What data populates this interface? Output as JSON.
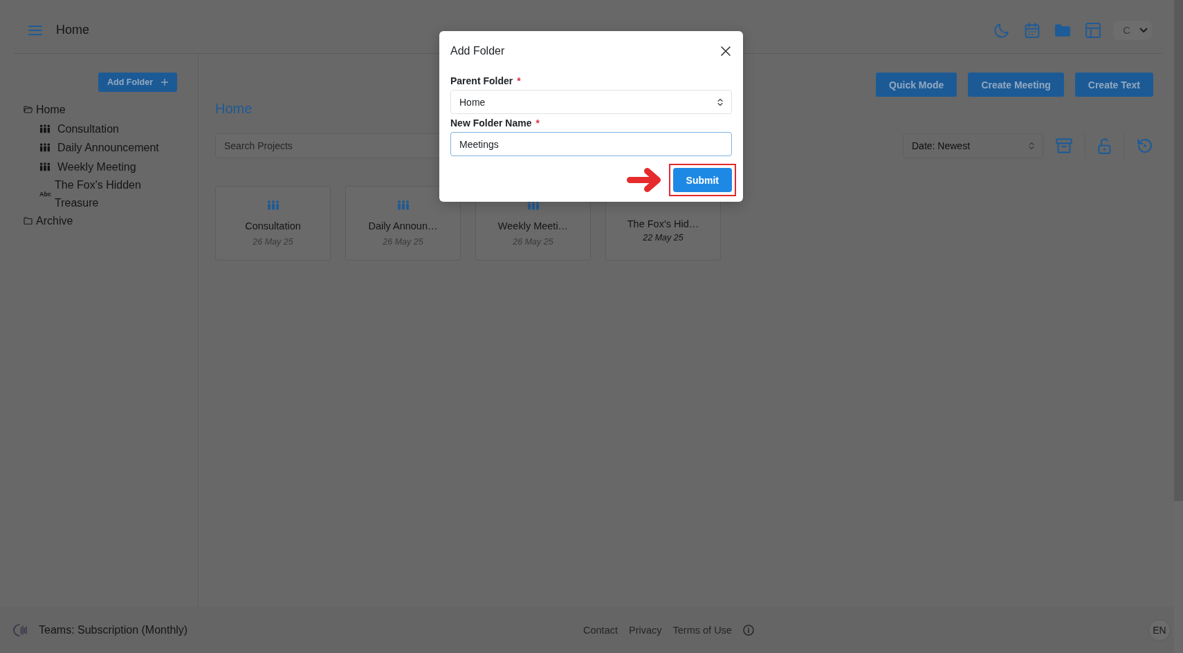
{
  "header": {
    "title": "Home",
    "user_initial": "C"
  },
  "sidebar": {
    "add_button": "Add Folder",
    "tree": [
      {
        "label": "Home",
        "kind": "folder",
        "expanded": true,
        "children": [
          {
            "label": "Consultation",
            "kind": "meeting"
          },
          {
            "label": "Daily Announcement",
            "kind": "meeting"
          },
          {
            "label": "Weekly Meeting",
            "kind": "meeting"
          },
          {
            "label": "The Fox's Hidden Treasure",
            "kind": "text",
            "icon_label": "Abc"
          }
        ]
      },
      {
        "label": "Archive",
        "kind": "folder",
        "expanded": false
      }
    ]
  },
  "main": {
    "actions": [
      "Quick Mode",
      "Create Meeting",
      "Create Text"
    ],
    "title": "Home",
    "search": {
      "placeholder": "Search Projects"
    },
    "sort": {
      "value": "Date: Newest"
    },
    "cards": [
      {
        "title": "Consultation",
        "date": "26 May 25",
        "kind": "meeting"
      },
      {
        "title": "Daily Announ…",
        "date": "26 May 25",
        "kind": "meeting"
      },
      {
        "title": "Weekly Meeti…",
        "date": "26 May 25",
        "kind": "meeting"
      },
      {
        "title": "The Fox's Hid…",
        "date": "22 May 25",
        "kind": "text"
      }
    ]
  },
  "dialog": {
    "title": "Add Folder",
    "fields": [
      {
        "kind": "select",
        "label": "Parent Folder",
        "required_mark": "*",
        "value": "Home",
        "focused": false
      },
      {
        "kind": "text",
        "label": "New Folder Name",
        "required_mark": "*",
        "value": "Meetings",
        "focused": true
      }
    ],
    "submit": {
      "label": "Submit",
      "highlighted": true
    }
  },
  "footer": {
    "plan": "Teams: Subscription (Monthly)",
    "links": [
      "Contact",
      "Privacy",
      "Terms of Use"
    ],
    "language": "EN"
  }
}
